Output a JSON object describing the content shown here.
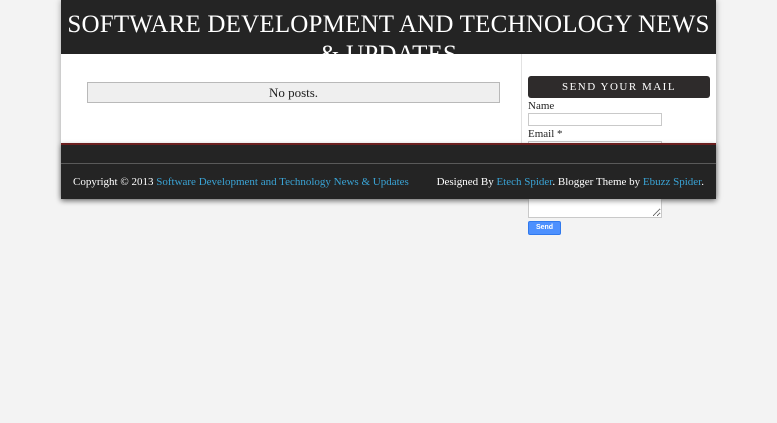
{
  "header": {
    "title": "SOFTWARE DEVELOPMENT AND TECHNOLOGY NEWS & UPDATES"
  },
  "main": {
    "no_posts": "No posts."
  },
  "sidebar": {
    "widget_title": "SEND YOUR MAIL",
    "name_label": "Name",
    "email_label": "Email *",
    "send_label": "Send"
  },
  "footer": {
    "copyright_prefix": "Copyright © 2013 ",
    "copyright_link": "Software Development and Technology News & Updates",
    "designed_by_prefix": "Designed By ",
    "designer_link": "Etech Spider",
    "theme_mid": ". Blogger Theme by ",
    "theme_link": "Ebuzz Spider",
    "suffix": "."
  },
  "colors": {
    "header_bg": "#242424",
    "link": "#3aa4d6",
    "button": "#4d90fe"
  }
}
